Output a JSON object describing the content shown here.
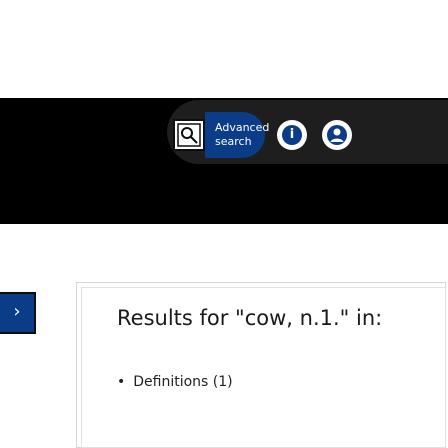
{
  "header": {
    "advanced_search": [
      "Advanced",
      "search"
    ],
    "icons": [
      "search-tool-icon",
      "info-icon",
      "user-icon"
    ],
    "accent_color": "#0b3c87"
  },
  "sidebar_toggle": {
    "label": "›"
  },
  "results": {
    "title": "Results for \"cow, n.1.\" in:",
    "items": [
      {
        "label": "Definitions (1)"
      }
    ]
  }
}
